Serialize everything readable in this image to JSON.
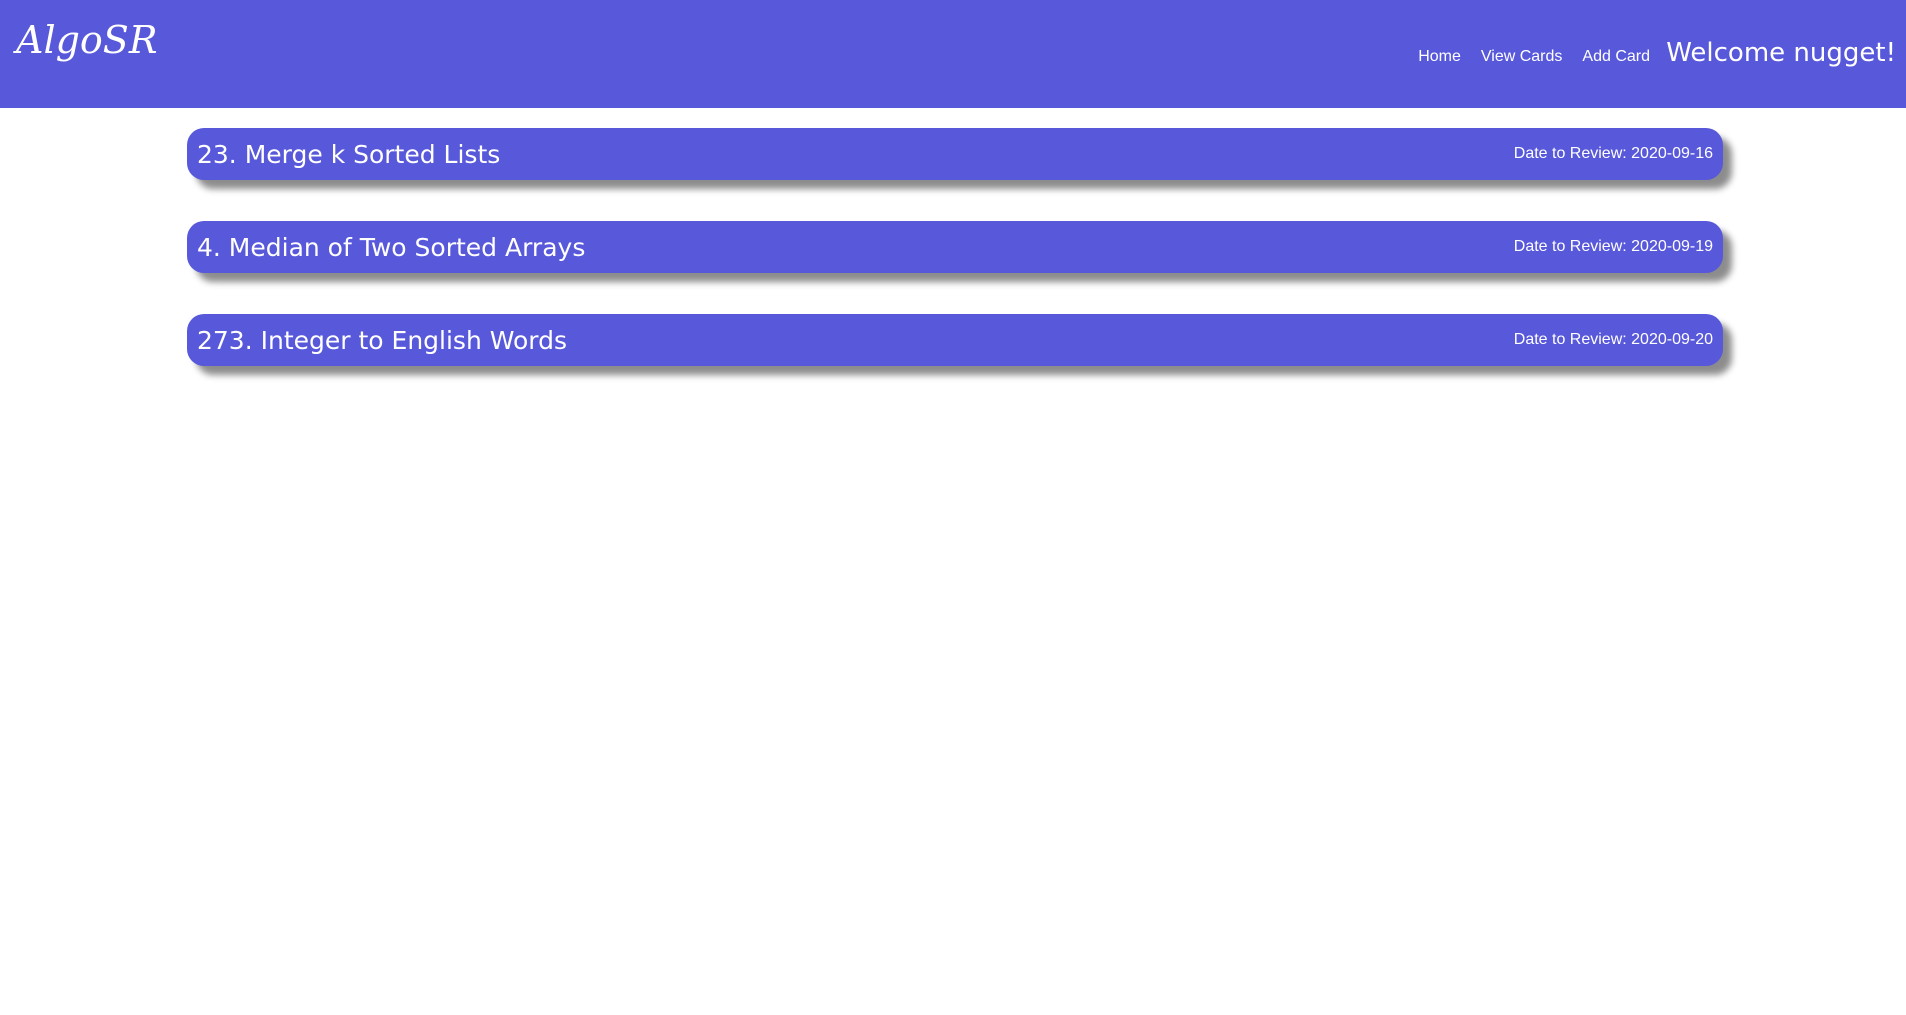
{
  "header": {
    "brand": "AlgoSR",
    "nav": [
      {
        "label": "Home"
      },
      {
        "label": "View Cards"
      },
      {
        "label": "Add Card"
      }
    ],
    "welcome": "Welcome nugget!"
  },
  "cards": [
    {
      "title": "23. Merge k Sorted Lists",
      "date": "Date to Review: 2020-09-16"
    },
    {
      "title": "4. Median of Two Sorted Arrays",
      "date": "Date to Review: 2020-09-19"
    },
    {
      "title": "273. Integer to English Words",
      "date": "Date to Review: 2020-09-20"
    }
  ],
  "colors": {
    "primary": "#5858db",
    "text": "#ffffff",
    "background": "#ffffff"
  }
}
